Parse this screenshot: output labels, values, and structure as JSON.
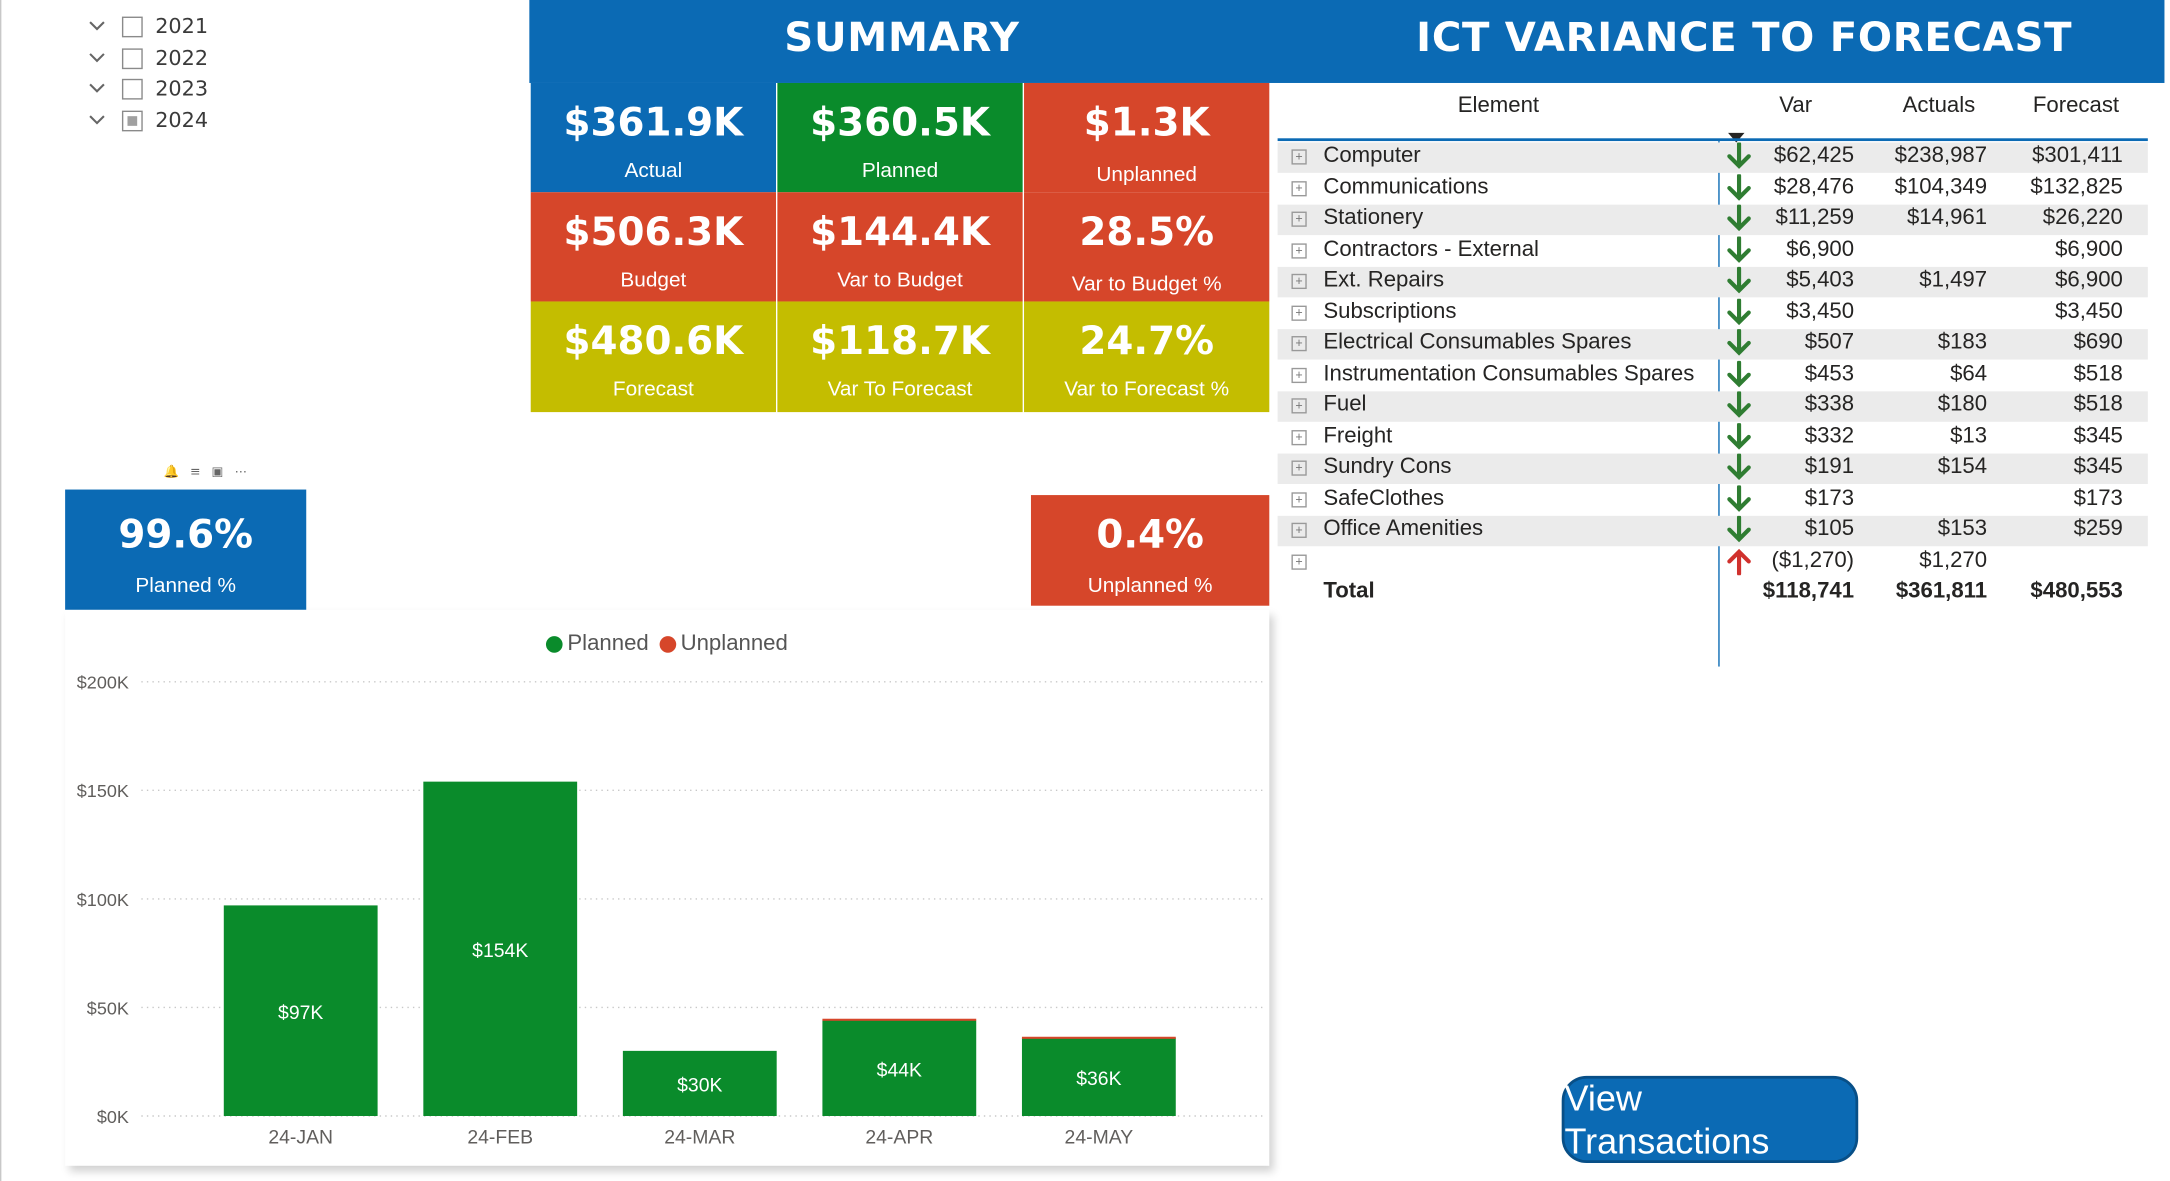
{
  "slicer": {
    "years": [
      {
        "label": "2021",
        "checked": false
      },
      {
        "label": "2022",
        "checked": false
      },
      {
        "label": "2023",
        "checked": false
      },
      {
        "label": "2024",
        "checked": true
      }
    ]
  },
  "summary": {
    "title": "SUMMARY",
    "tiles": [
      {
        "value": "$361.9K",
        "label": "Actual"
      },
      {
        "value": "$360.5K",
        "label": "Planned"
      },
      {
        "value": "$1.3K",
        "label": "Unplanned"
      },
      {
        "value": "$506.3K",
        "label": "Budget"
      },
      {
        "value": "$144.4K",
        "label": "Var to Budget"
      },
      {
        "value": "28.5%",
        "label": "Var to Budget %"
      },
      {
        "value": "$480.6K",
        "label": "Forecast"
      },
      {
        "value": "$118.7K",
        "label": "Var To Forecast"
      },
      {
        "value": "24.7%",
        "label": "Var to Forecast %"
      }
    ]
  },
  "variance": {
    "title": "ICT VARIANCE TO FORECAST",
    "headers": {
      "element": "Element",
      "var": "Var",
      "actuals": "Actuals",
      "forecast": "Forecast"
    },
    "rows": [
      {
        "element": "Computer",
        "var": "$62,425",
        "actuals": "$238,987",
        "forecast": "$301,411",
        "trend": "down"
      },
      {
        "element": "Communications",
        "var": "$28,476",
        "actuals": "$104,349",
        "forecast": "$132,825",
        "trend": "down"
      },
      {
        "element": "Stationery",
        "var": "$11,259",
        "actuals": "$14,961",
        "forecast": "$26,220",
        "trend": "down"
      },
      {
        "element": "Contractors - External",
        "var": "$6,900",
        "actuals": "",
        "forecast": "$6,900",
        "trend": "down"
      },
      {
        "element": "Ext. Repairs",
        "var": "$5,403",
        "actuals": "$1,497",
        "forecast": "$6,900",
        "trend": "down"
      },
      {
        "element": "Subscriptions",
        "var": "$3,450",
        "actuals": "",
        "forecast": "$3,450",
        "trend": "down"
      },
      {
        "element": "Electrical Consumables Spares",
        "var": "$507",
        "actuals": "$183",
        "forecast": "$690",
        "trend": "down"
      },
      {
        "element": "Instrumentation Consumables Spares",
        "var": "$453",
        "actuals": "$64",
        "forecast": "$518",
        "trend": "down"
      },
      {
        "element": "Fuel",
        "var": "$338",
        "actuals": "$180",
        "forecast": "$518",
        "trend": "down"
      },
      {
        "element": "Freight",
        "var": "$332",
        "actuals": "$13",
        "forecast": "$345",
        "trend": "down"
      },
      {
        "element": "Sundry Cons",
        "var": "$191",
        "actuals": "$154",
        "forecast": "$345",
        "trend": "down"
      },
      {
        "element": "SafeClothes",
        "var": "$173",
        "actuals": "",
        "forecast": "$173",
        "trend": "down"
      },
      {
        "element": "Office Amenities",
        "var": "$105",
        "actuals": "$153",
        "forecast": "$259",
        "trend": "down"
      },
      {
        "element": "",
        "var": "($1,270)",
        "actuals": "$1,270",
        "forecast": "",
        "trend": "up"
      }
    ],
    "total": {
      "element": "Total",
      "var": "$118,741",
      "actuals": "$361,811",
      "forecast": "$480,553"
    }
  },
  "percent_tiles": {
    "planned": {
      "value": "99.6%",
      "label": "Planned %"
    },
    "unplanned": {
      "value": "0.4%",
      "label": "Unplanned %"
    }
  },
  "colors": {
    "blue": "#0b6ab4",
    "green": "#0a8b2b",
    "red": "#d6462a",
    "olive": "#c4bd00"
  },
  "icons": [
    "chevron-down-icon",
    "checkbox-icon",
    "expand-icon",
    "arrow-down-icon",
    "arrow-up-icon",
    "sort-desc-icon",
    "pin-icon",
    "filter-icon",
    "focus-icon",
    "more-options-icon"
  ],
  "chart_data": {
    "type": "bar",
    "stacked": true,
    "categories": [
      "24-JAN",
      "24-FEB",
      "24-MAR",
      "24-APR",
      "24-MAY"
    ],
    "series": [
      {
        "name": "Planned",
        "color": "#0a8b2b",
        "values": [
          97000,
          154000,
          30000,
          44000,
          36000
        ]
      },
      {
        "name": "Unplanned",
        "color": "#d6462a",
        "values": [
          0,
          0,
          0,
          800,
          500
        ]
      }
    ],
    "data_labels": [
      "$97K",
      "$154K",
      "$30K",
      "$44K",
      "$36K"
    ],
    "y_ticks": [
      "$0K",
      "$50K",
      "$100K",
      "$150K",
      "$200K"
    ],
    "ylim": [
      0,
      200000
    ],
    "legend": "top-center",
    "grid": true
  },
  "button": {
    "label": "View Transactions"
  }
}
